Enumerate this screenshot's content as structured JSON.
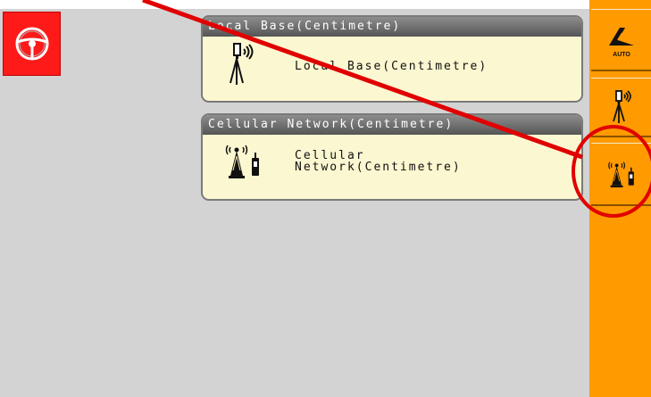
{
  "colors": {
    "accent": "#ff9a00",
    "alert": "#ff1a1a",
    "card_bg": "#fbf7d1",
    "annotation": "#e00000"
  },
  "top_left": {
    "button_icon": "steering-wheel-icon"
  },
  "cards": [
    {
      "header": "Local Base(Centimetre)",
      "label": "Local Base(Centimetre)",
      "icon": "local-base-icon"
    },
    {
      "header": "Cellular Network(Centimetre)",
      "label": "Cellular\nNetwork(Centimetre)",
      "icon": "cellular-network-icon"
    }
  ],
  "sidebar": {
    "auto_button": {
      "icon": "auto-steer-icon",
      "text": "AUTO"
    },
    "base_button": {
      "icon": "local-base-icon"
    },
    "cell_button": {
      "icon": "cellular-network-icon"
    }
  }
}
